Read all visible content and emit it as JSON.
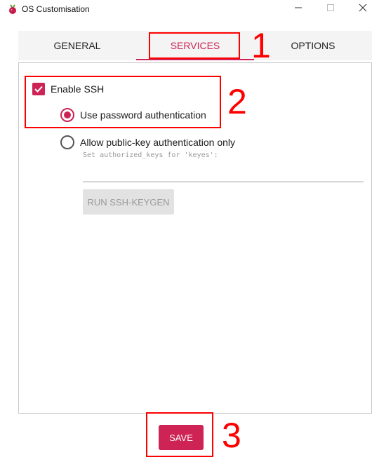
{
  "window": {
    "title": "OS Customisation",
    "controls": [
      "minimize",
      "maximize",
      "close"
    ]
  },
  "tabs": [
    {
      "label": "GENERAL",
      "active": false
    },
    {
      "label": "SERVICES",
      "active": true
    },
    {
      "label": "OPTIONS",
      "active": false
    }
  ],
  "services": {
    "enable_ssh": {
      "label": "Enable SSH",
      "checked": true
    },
    "auth_password": {
      "label": "Use password authentication",
      "selected": true
    },
    "auth_pubkey": {
      "label": "Allow public-key authentication only",
      "selected": false
    },
    "authorized_keys_hint": "Set authorized_keys for 'keyes':",
    "authorized_keys_value": "",
    "keygen_button": "RUN SSH-KEYGEN"
  },
  "footer": {
    "save_label": "SAVE"
  },
  "annotations": [
    "1",
    "2",
    "3"
  ],
  "colors": {
    "accent": "#cd2355",
    "annotation": "#ff0000",
    "tab_bg": "#f4f4f4",
    "disabled_bg": "#e2e2e2"
  },
  "icons": [
    "raspberry-pi-icon",
    "minimize-icon",
    "maximize-icon",
    "close-icon",
    "check-icon"
  ]
}
